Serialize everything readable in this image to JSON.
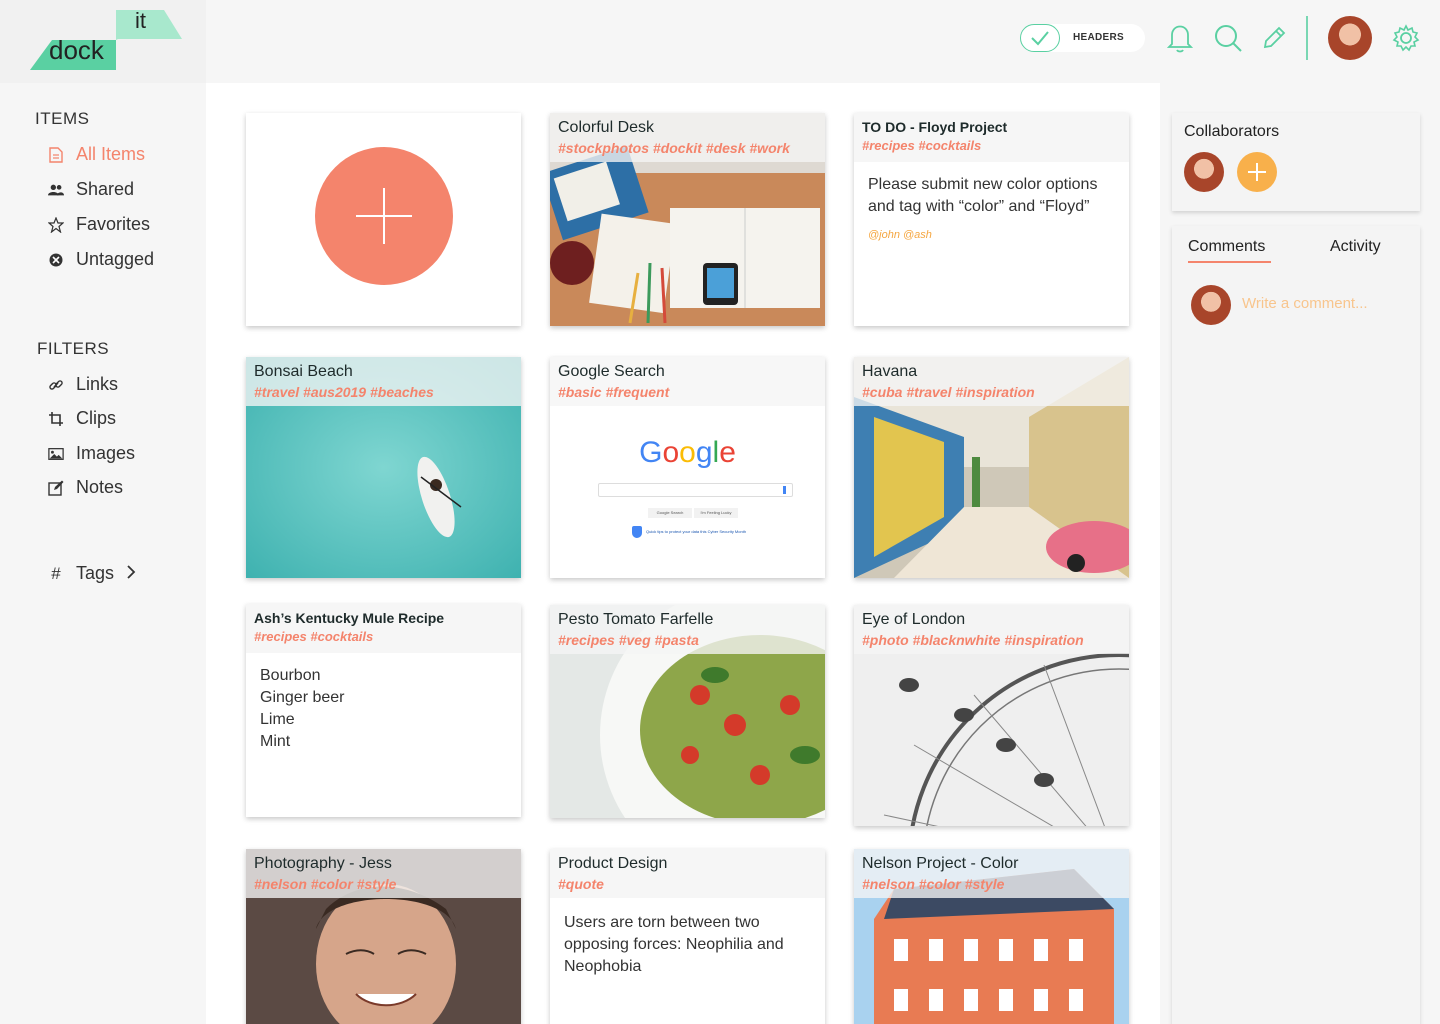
{
  "app": {
    "logo_word1": "dock",
    "logo_word2": "it"
  },
  "topbar": {
    "headers_label": "HEADERS",
    "headers_checked": true,
    "icons": [
      "bell-icon",
      "search-icon",
      "pencil-icon",
      "avatar",
      "gear-icon"
    ],
    "accent_color": "#5ad0a2"
  },
  "sidebar": {
    "items_title": "ITEMS",
    "items": [
      {
        "label": "All Items",
        "icon": "document-icon",
        "active": true
      },
      {
        "label": "Shared",
        "icon": "users-icon",
        "active": false
      },
      {
        "label": "Favorites",
        "icon": "star-icon",
        "active": false
      },
      {
        "label": "Untagged",
        "icon": "untagged-icon",
        "active": false
      }
    ],
    "filters_title": "FILTERS",
    "filters": [
      {
        "label": "Links",
        "icon": "link-icon"
      },
      {
        "label": "Clips",
        "icon": "crop-icon"
      },
      {
        "label": "Images",
        "icon": "image-icon"
      },
      {
        "label": "Notes",
        "icon": "note-icon"
      }
    ],
    "tags_label": "Tags",
    "tags_icon": "#"
  },
  "cards": {
    "colorful_desk": {
      "title": "Colorful Desk",
      "tags": "#stockphotos #dockit #desk #work"
    },
    "todo": {
      "title": "TO DO - Floyd Project",
      "tags": "#recipes #cocktails",
      "body": "Please submit new color options and tag with “color” and “Floyd”",
      "mention": "@john @ash"
    },
    "bonsai": {
      "title": "Bonsai Beach",
      "tags": "#travel #aus2019 #beaches"
    },
    "google": {
      "title": "Google Search",
      "tags": "#basic #frequent",
      "logo": "Google",
      "btn1": "Google Search",
      "btn2": "I'm Feeling Lucky",
      "note": "Quick tips to protect your data this Cyber Security Month"
    },
    "havana": {
      "title": "Havana",
      "tags": "#cuba #travel #inspiration"
    },
    "mule": {
      "title": "Ash’s Kentucky Mule Recipe",
      "tags": "#recipes #cocktails",
      "lines": [
        "Bourbon",
        "Ginger beer",
        "Lime",
        "Mint"
      ]
    },
    "pesto": {
      "title": "Pesto Tomato Farfelle",
      "tags": "#recipes #veg #pasta"
    },
    "london": {
      "title": "Eye of London",
      "tags": "#photo #blacknwhite #inspiration"
    },
    "photo_jess": {
      "title": "Photography - Jess",
      "tags": "#nelson #color #style"
    },
    "product": {
      "title": "Product Design",
      "tags": "#quote",
      "body": "Users are torn between two opposing forces: Neophilia and Neophobia"
    },
    "nelson": {
      "title": "Nelson Project - Color",
      "tags": "#nelson #color #style"
    }
  },
  "right_panel": {
    "collaborators_title": "Collaborators",
    "tabs": [
      "Comments",
      "Activity"
    ],
    "active_tab": "Comments",
    "comment_placeholder": "Write a comment..."
  },
  "colors": {
    "accent_coral": "#f4846c",
    "accent_orange": "#f8b04b",
    "accent_green": "#5ad0a2"
  }
}
